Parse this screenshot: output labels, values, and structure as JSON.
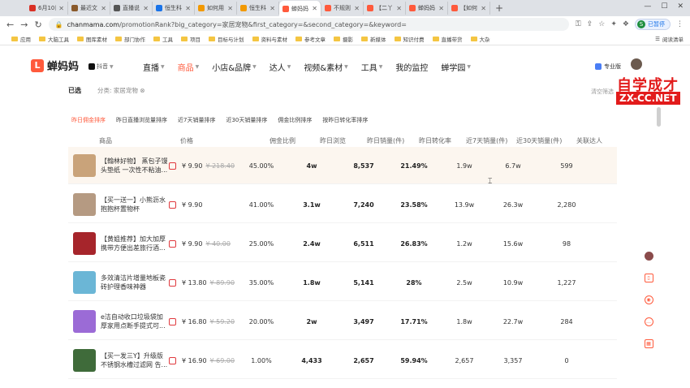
{
  "browser": {
    "tabs": [
      {
        "label": "6月10日",
        "color": "#d93025"
      },
      {
        "label": "最近文",
        "color": "#8a5a2b"
      },
      {
        "label": "直播说",
        "color": "#555555"
      },
      {
        "label": "恒生科",
        "color": "#1a73e8"
      },
      {
        "label": "如何用",
        "color": "#f29900"
      },
      {
        "label": "恒生科",
        "color": "#f29900"
      },
      {
        "label": "蝉妈妈",
        "color": "#ff5a3c",
        "active": true
      },
      {
        "label": "不规则",
        "color": "#ff5a3c"
      },
      {
        "label": "【二丫",
        "color": "#ff5a3c"
      },
      {
        "label": "蝉妈妈",
        "color": "#ff5a3c"
      },
      {
        "label": "【如何",
        "color": "#ff5a3c"
      }
    ],
    "url_host": "chanmama.com",
    "url_path": "/promotionRank?big_category=家居宠物&first_category=&second_category=&keyword=",
    "profile_status": "已暂停",
    "profile_initial": "S",
    "bookmarks": [
      "应用",
      "大脑工具",
      "图库素材",
      "部门协作",
      "工具",
      "项目",
      "目标与计划",
      "资料与素材",
      "参考文章",
      "摄影",
      "新媒体",
      "知识付费",
      "直播带货",
      "大杂"
    ],
    "reading_list": "阅读清单"
  },
  "site": {
    "logo_text": "蝉妈妈",
    "platform": "抖音",
    "nav": [
      {
        "label": "直播",
        "dropdown": true
      },
      {
        "label": "商品",
        "dropdown": true,
        "active": true
      },
      {
        "label": "小店&品牌",
        "dropdown": true
      },
      {
        "label": "达人",
        "dropdown": true
      },
      {
        "label": "视频&素材",
        "dropdown": true
      },
      {
        "label": "工具",
        "dropdown": true
      },
      {
        "label": "我的监控",
        "dropdown": false
      },
      {
        "label": "蝉学园",
        "dropdown": true
      }
    ],
    "pro_label": "专业版"
  },
  "watermark": {
    "line1": "自学成才",
    "line2": "ZX-CC.NET"
  },
  "filters": {
    "selected_label": "已选",
    "category": "分类: 家居宠物",
    "clear": "清空筛选"
  },
  "sort_tabs": [
    "昨日佣金排序",
    "昨日直播浏览量排序",
    "近7天销量排序",
    "近30天销量排序",
    "佣金比例排序",
    "按昨日转化率排序"
  ],
  "table": {
    "headers": [
      "商品",
      "价格",
      "佣金比例",
      "昨日浏览",
      "昨日销量(件)",
      "昨日转化率",
      "近7天销量(件)",
      "近30天销量(件)",
      "关联达人"
    ],
    "rows": [
      {
        "name": "【翰林好物】 蒸包子馒头垫纸 一次性不粘油...",
        "price": "¥ 9.90",
        "old_price": "¥ 218.40",
        "commission": "45.00%",
        "views": "4w",
        "sales": "8,537",
        "conv": "21.49%",
        "sales7": "1.9w",
        "sales30": "6.7w",
        "kols": "599",
        "thumb": "#c9a37a"
      },
      {
        "name": "【买一送一】小熊沥水抱抱杯置物杯",
        "price": "¥ 9.90",
        "old_price": "",
        "commission": "41.00%",
        "views": "3.1w",
        "sales": "7,240",
        "conv": "23.58%",
        "sales7": "13.9w",
        "sales30": "26.3w",
        "kols": "2,280",
        "thumb": "#b59a82"
      },
      {
        "name": "【黄姐推荐】加大加厚携带方便出差旅行酒...",
        "price": "¥ 9.90",
        "old_price": "¥ 40.00",
        "commission": "25.00%",
        "views": "2.4w",
        "sales": "6,511",
        "conv": "26.83%",
        "sales7": "1.2w",
        "sales30": "15.6w",
        "kols": "98",
        "thumb": "#a6252b"
      },
      {
        "name": "多效清洁片增量地板瓷砖护理香味神器",
        "price": "¥ 13.80",
        "old_price": "¥ 89.90",
        "commission": "35.00%",
        "views": "1.8w",
        "sales": "5,141",
        "conv": "28%",
        "sales7": "2.5w",
        "sales30": "10.9w",
        "kols": "1,227",
        "thumb": "#6bb6d6"
      },
      {
        "name": "e洁自动收口垃圾袋加厚家用点断手提式可...",
        "price": "¥ 16.80",
        "old_price": "¥ 59.20",
        "commission": "20.00%",
        "views": "2w",
        "sales": "3,497",
        "conv": "17.71%",
        "sales7": "1.8w",
        "sales30": "22.7w",
        "kols": "284",
        "thumb": "#9b6bd6"
      },
      {
        "name": "【买一发三Y】升级版不锈钢水槽过滤网 告...",
        "price": "¥ 16.90",
        "old_price": "¥ 69.00",
        "commission": "1.00%",
        "views": "4,433",
        "sales": "2,657",
        "conv": "59.94%",
        "sales7": "2,657",
        "sales30": "3,357",
        "kols": "0",
        "thumb": "#3f6b3a"
      }
    ]
  }
}
